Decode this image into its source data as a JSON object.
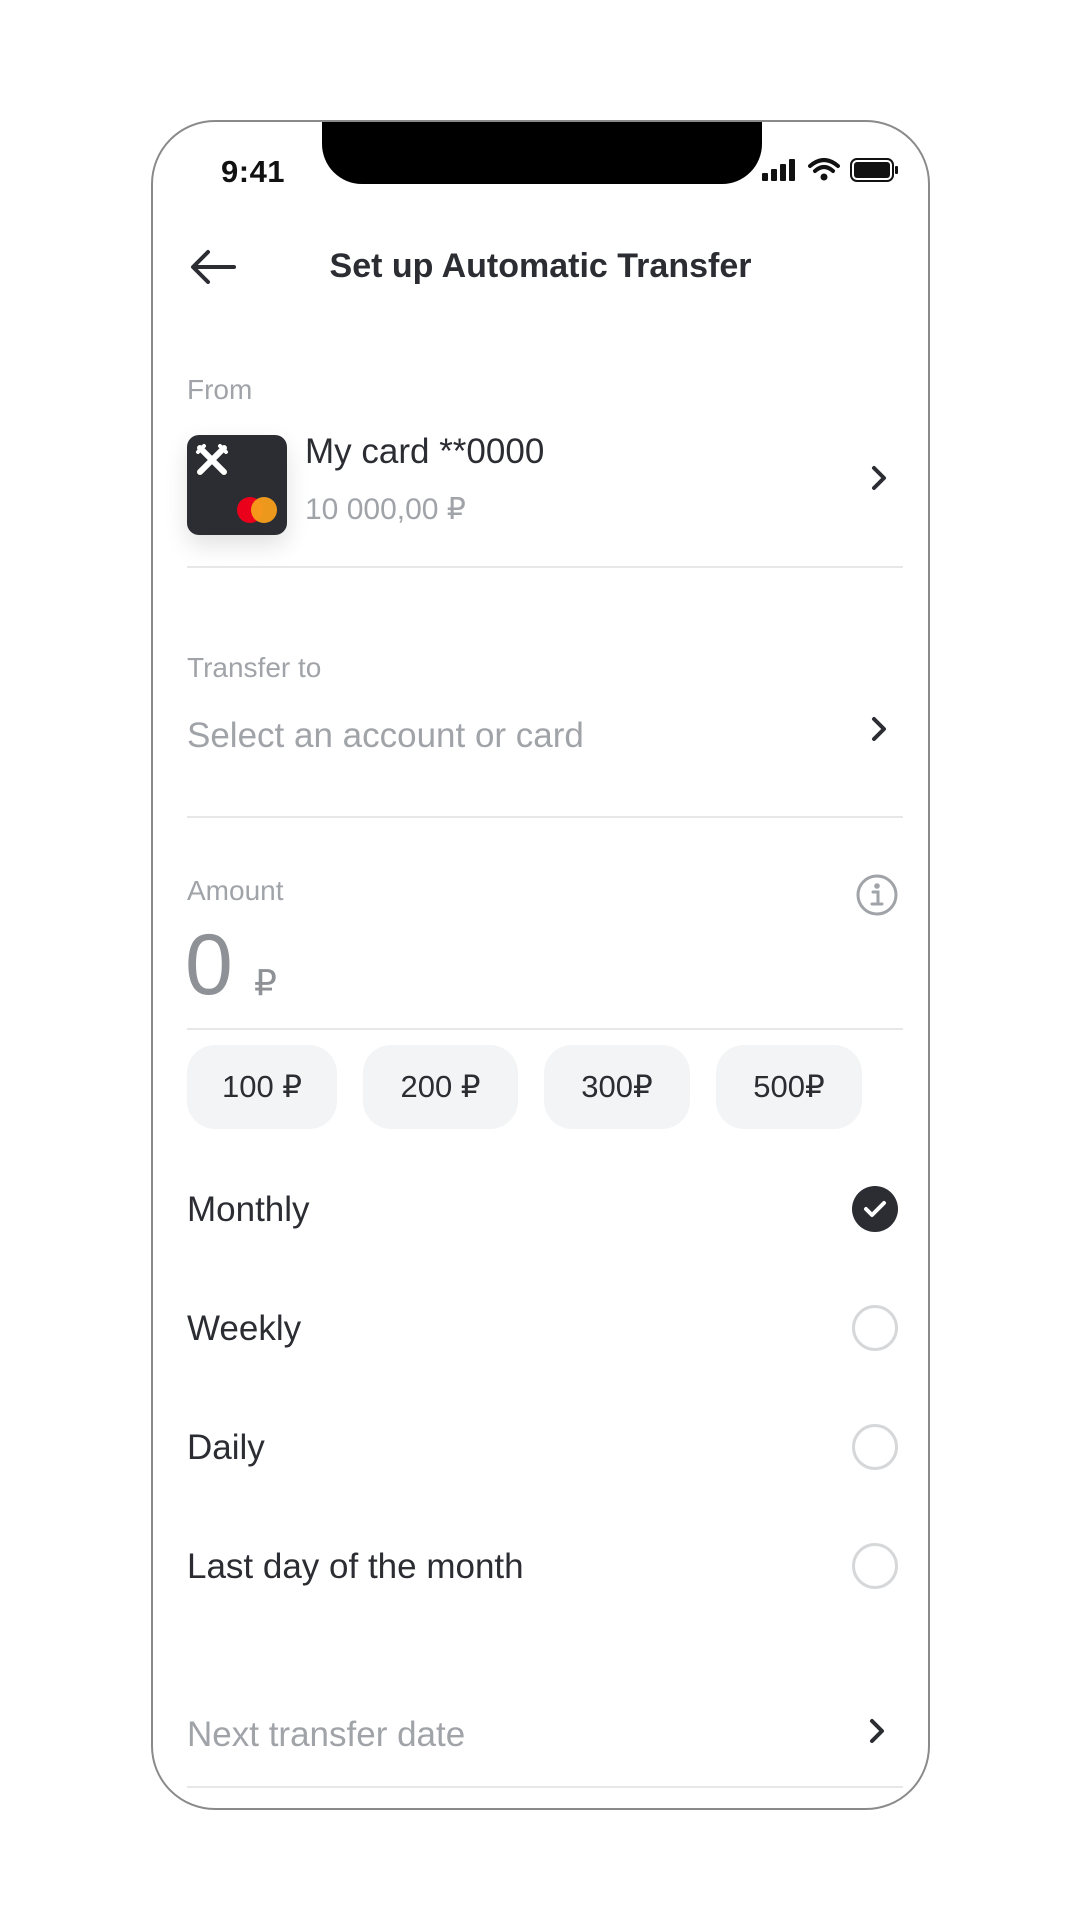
{
  "status_bar": {
    "time": "9:41"
  },
  "header": {
    "title": "Set up Automatic Transfer"
  },
  "from": {
    "label": "From",
    "card_name": "My card **0000",
    "balance": "10 000,00 ₽"
  },
  "transfer_to": {
    "label": "Transfer to",
    "placeholder": "Select an account or card"
  },
  "amount": {
    "label": "Amount",
    "value": "0",
    "currency": "₽"
  },
  "quick_amounts": [
    "100 ₽",
    "200 ₽",
    "300₽",
    "500₽"
  ],
  "frequency": {
    "options": [
      {
        "label": "Monthly",
        "selected": true
      },
      {
        "label": "Weekly",
        "selected": false
      },
      {
        "label": "Daily",
        "selected": false
      },
      {
        "label": "Last day of the month",
        "selected": false
      }
    ]
  },
  "next_date": {
    "label": "Next transfer date"
  },
  "colors": {
    "text": "#2b2d33",
    "muted": "#a0a3a8",
    "chip_bg": "#f3f4f5",
    "card_bg": "#2b2d33",
    "mastercard_red": "#eb001b",
    "mastercard_orange": "#f79e1b"
  },
  "icons": [
    "back-arrow-icon",
    "chevron-right-icon",
    "info-icon",
    "check-icon",
    "signal-icon",
    "wifi-icon",
    "battery-icon",
    "bank-logo-icon",
    "mastercard-icon"
  ]
}
